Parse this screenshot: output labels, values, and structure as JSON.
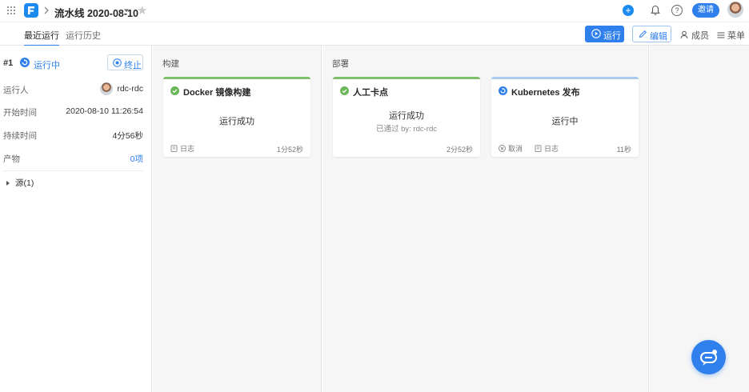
{
  "header": {
    "title": "流水线 2020-08-10",
    "plus": "+",
    "help": "?",
    "invite_label": "邀请",
    "logo_text": "F"
  },
  "tabs": {
    "recent": "最近运行",
    "history": "运行历史"
  },
  "toolbar": {
    "run_label": "运行",
    "edit_label": "编辑",
    "members_label": "成员",
    "menu_label": "菜单"
  },
  "run": {
    "number": "#1",
    "status": "运行中",
    "stop_label": "终止",
    "runner_key": "运行人",
    "runner_value": "rdc-rdc",
    "start_key": "开始时间",
    "start_value": "2020-08-10 11:26:54",
    "duration_key": "持续时间",
    "duration_value": "4分56秒",
    "artifacts_key": "产物",
    "artifacts_value": "0项",
    "source_label": "源(1)"
  },
  "stages": {
    "build": {
      "title": "构建",
      "card": {
        "name": "Docker 镜像构建",
        "status": "运行成功",
        "log_label": "日志",
        "duration": "1分52秒"
      }
    },
    "deploy": {
      "title": "部署",
      "cards": [
        {
          "name": "人工卡点",
          "status": "运行成功",
          "sub": "已通过 by: rdc-rdc",
          "duration": "2分52秒"
        },
        {
          "name": "Kubernetes 发布",
          "status": "运行中",
          "cancel_label": "取消",
          "log_label": "日志",
          "duration": "11秒"
        }
      ]
    }
  },
  "colors": {
    "accent": "#2f80ed",
    "success": "#7cc06b",
    "running_bar": "#a9cbf0"
  }
}
